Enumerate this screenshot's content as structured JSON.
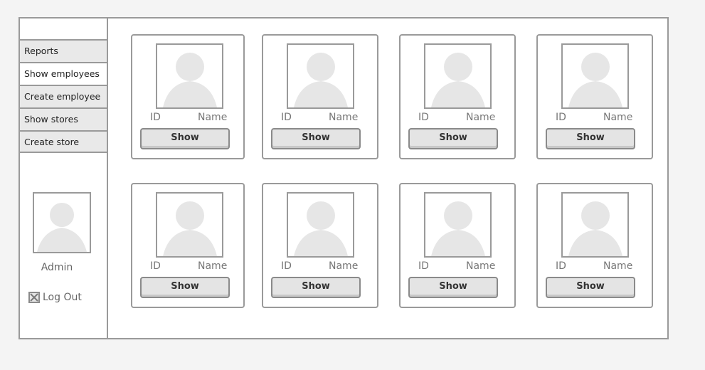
{
  "sidebar": {
    "items": [
      {
        "label": "Reports"
      },
      {
        "label": "Show employees"
      },
      {
        "label": "Create employee"
      },
      {
        "label": "Show stores"
      },
      {
        "label": "Create store"
      }
    ],
    "user": {
      "name": "Admin",
      "avatar_icon": "person-silhouette-icon"
    },
    "logout": {
      "label": "Log Out",
      "icon": "close-box-icon"
    }
  },
  "employees": [
    {
      "id_label": "ID",
      "name_label": "Name",
      "button_label": "Show"
    },
    {
      "id_label": "ID",
      "name_label": "Name",
      "button_label": "Show"
    },
    {
      "id_label": "ID",
      "name_label": "Name",
      "button_label": "Show"
    },
    {
      "id_label": "ID",
      "name_label": "Name",
      "button_label": "Show"
    },
    {
      "id_label": "ID",
      "name_label": "Name",
      "button_label": "Show"
    },
    {
      "id_label": "ID",
      "name_label": "Name",
      "button_label": "Show"
    },
    {
      "id_label": "ID",
      "name_label": "Name",
      "button_label": "Show"
    },
    {
      "id_label": "ID",
      "name_label": "Name",
      "button_label": "Show"
    }
  ],
  "colors": {
    "border": "#9a9a9a",
    "silhouette": "#e6e6e6",
    "page_bg": "#f4f4f4"
  }
}
